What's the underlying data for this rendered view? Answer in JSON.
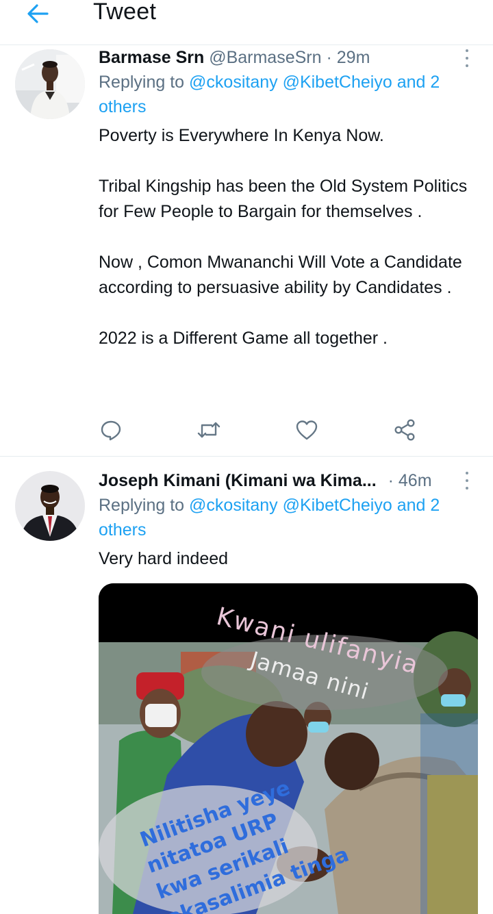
{
  "header": {
    "title": "Tweet"
  },
  "tweets": [
    {
      "name": "Barmase Srn",
      "handle": "@BarmaseSrn",
      "time": "· 29m",
      "replying_to": "Replying to",
      "mentions": "@ckositany @KibetCheiyo and 2 others",
      "paragraphs": [
        "Poverty is Everywhere In Kenya Now.",
        "Tribal Kingship has been the Old System Politics for Few People to Bargain for themselves .",
        "Now , Comon Mwananchi Will Vote a Candidate according to persuasive ability by Candidates .",
        "2022 is a Different Game all together ."
      ]
    },
    {
      "name": "Joseph Kimani (Kimani wa Kima...",
      "time": "· 46m",
      "replying_to": "Replying to",
      "mentions": "@ckositany @KibetCheiyo and 2 others",
      "text": "Very hard indeed",
      "image_captions": {
        "top_line1": "Kwani ulifanyia",
        "top_line2": "Jamaa nini",
        "bottom_line1": "Nilitisha yeye",
        "bottom_line2": "nitatoa URP",
        "bottom_line3": "kwa serikali",
        "bottom_line4": "akasalimia tinga"
      }
    }
  ],
  "icons": {
    "back": "arrow-left-icon",
    "more": "more-vertical-icon",
    "reply": "comment-icon",
    "retweet": "retweet-icon",
    "like": "heart-icon",
    "share": "share-icon"
  },
  "colors": {
    "accent": "#1da1f2",
    "secondary_text": "#5b7083",
    "icon": "#657786"
  }
}
